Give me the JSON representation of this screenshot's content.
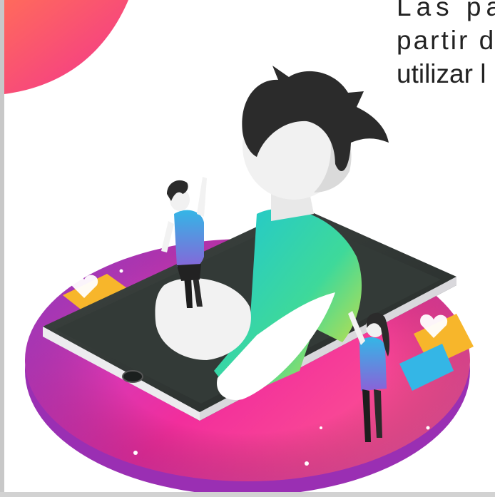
{
  "article": {
    "lines": [
      "Las pa",
      "partir d",
      "utilizar l"
    ]
  },
  "illustration": {
    "subject": "person using a giant smartphone with small figures",
    "colors": {
      "disc_pink": "#f22e9c",
      "disc_purple": "#b443d6",
      "corner_pink": "#f7446f",
      "phone_dark": "#2e3431",
      "skin": "#f0f0f0",
      "hair": "#2b2b2b",
      "shirt_green": "#2fd3b3",
      "shirt_yellow": "#f5e12b"
    }
  }
}
